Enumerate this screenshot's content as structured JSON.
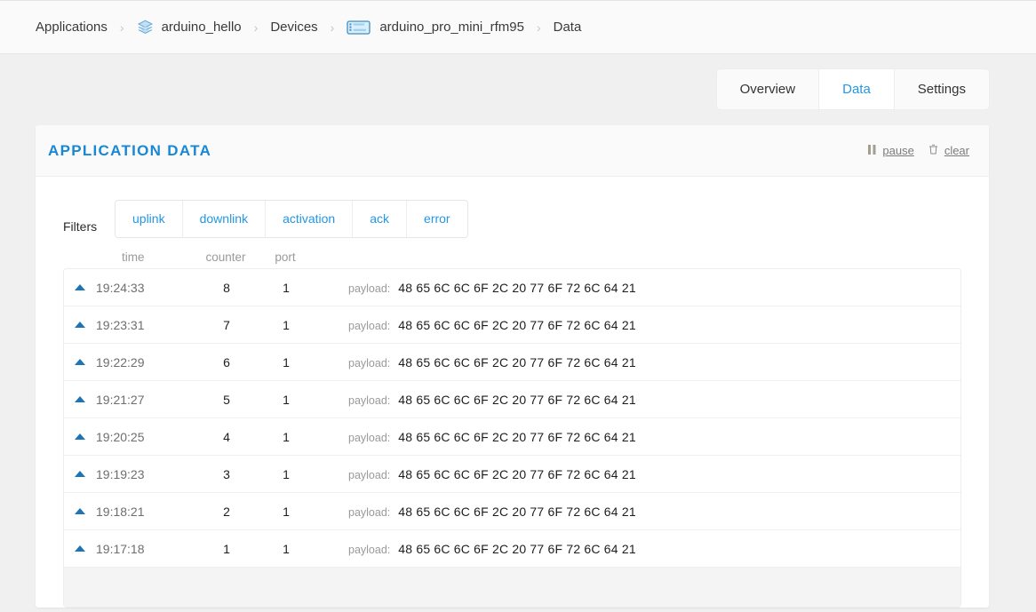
{
  "breadcrumb": {
    "items": [
      {
        "label": "Applications",
        "icon": ""
      },
      {
        "label": "arduino_hello",
        "icon": "layers-icon"
      },
      {
        "label": "Devices",
        "icon": ""
      },
      {
        "label": "arduino_pro_mini_rfm95",
        "icon": "device-board-icon"
      },
      {
        "label": "Data",
        "icon": ""
      }
    ],
    "separator": "›"
  },
  "tabs": [
    {
      "label": "Overview",
      "active": false
    },
    {
      "label": "Data",
      "active": true
    },
    {
      "label": "Settings",
      "active": false
    }
  ],
  "card": {
    "title": "APPLICATION DATA",
    "actions": [
      {
        "label": "pause",
        "icon": "pause-icon"
      },
      {
        "label": "clear",
        "icon": "trash-icon"
      }
    ]
  },
  "filters": {
    "label": "Filters",
    "options": [
      "uplink",
      "downlink",
      "activation",
      "ack",
      "error"
    ]
  },
  "table": {
    "columns": [
      "time",
      "counter",
      "port"
    ],
    "payload_label": "payload:",
    "rows": [
      {
        "direction": "uplink",
        "time": "19:24:33",
        "counter": "8",
        "port": "1",
        "payload": "48 65 6C 6C 6F 2C 20 77 6F 72 6C 64 21"
      },
      {
        "direction": "uplink",
        "time": "19:23:31",
        "counter": "7",
        "port": "1",
        "payload": "48 65 6C 6C 6F 2C 20 77 6F 72 6C 64 21"
      },
      {
        "direction": "uplink",
        "time": "19:22:29",
        "counter": "6",
        "port": "1",
        "payload": "48 65 6C 6C 6F 2C 20 77 6F 72 6C 64 21"
      },
      {
        "direction": "uplink",
        "time": "19:21:27",
        "counter": "5",
        "port": "1",
        "payload": "48 65 6C 6C 6F 2C 20 77 6F 72 6C 64 21"
      },
      {
        "direction": "uplink",
        "time": "19:20:25",
        "counter": "4",
        "port": "1",
        "payload": "48 65 6C 6C 6F 2C 20 77 6F 72 6C 64 21"
      },
      {
        "direction": "uplink",
        "time": "19:19:23",
        "counter": "3",
        "port": "1",
        "payload": "48 65 6C 6C 6F 2C 20 77 6F 72 6C 64 21"
      },
      {
        "direction": "uplink",
        "time": "19:18:21",
        "counter": "2",
        "port": "1",
        "payload": "48 65 6C 6C 6F 2C 20 77 6F 72 6C 64 21"
      },
      {
        "direction": "uplink",
        "time": "19:17:18",
        "counter": "1",
        "port": "1",
        "payload": "48 65 6C 6C 6F 2C 20 77 6F 72 6C 64 21"
      }
    ]
  },
  "colors": {
    "accent": "#2397e4",
    "title": "#1887d4",
    "uplink_arrow": "#1f74b6",
    "page_bg": "#f0f0f0"
  }
}
